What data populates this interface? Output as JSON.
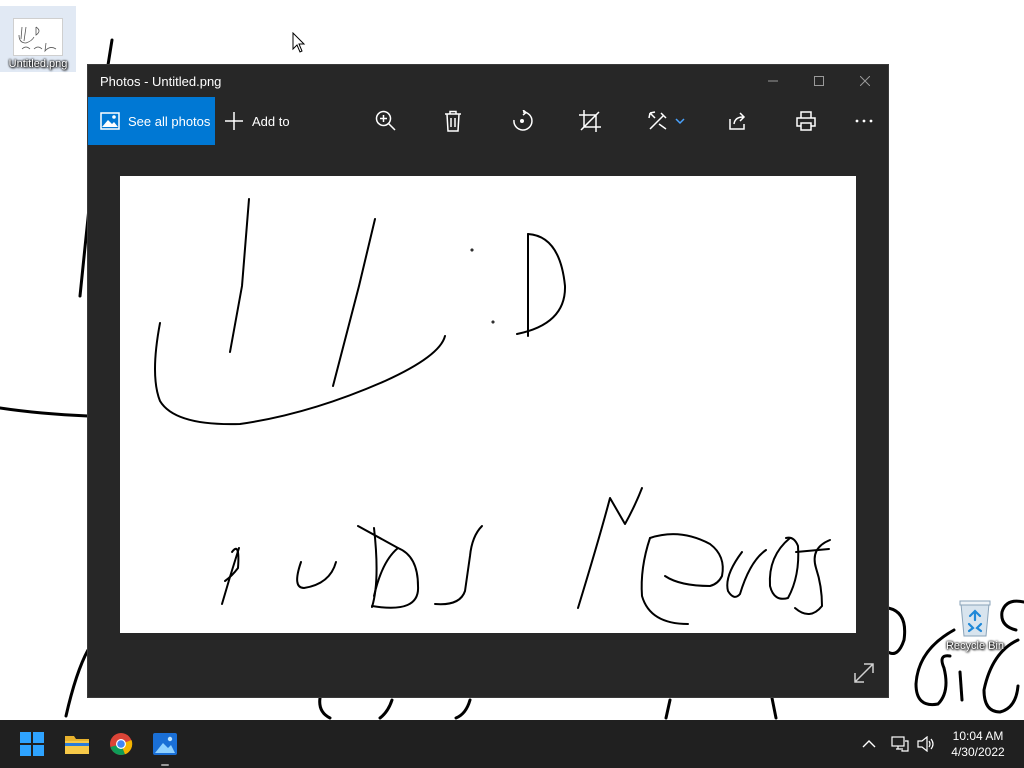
{
  "desktop": {
    "icons": [
      {
        "label": "Untitled.png"
      },
      {
        "label": "Recycle Bin"
      }
    ]
  },
  "window": {
    "title": "Photos - Untitled.png",
    "toolbar": {
      "see_all_label": "See all photos",
      "add_to_label": "Add to"
    },
    "tool_icons": [
      "zoom-in-icon",
      "delete-icon",
      "rotate-icon",
      "crop-icon",
      "edit-icon",
      "share-icon",
      "print-icon",
      "more-icon"
    ]
  },
  "taskbar": {
    "apps": [
      "start",
      "file-explorer",
      "chrome",
      "photos"
    ],
    "clock_time": "10:04 AM",
    "clock_date": "4/30/2022"
  },
  "colors": {
    "accent": "#0078d4",
    "window_bg": "#272727",
    "taskbar_bg": "#202020"
  }
}
